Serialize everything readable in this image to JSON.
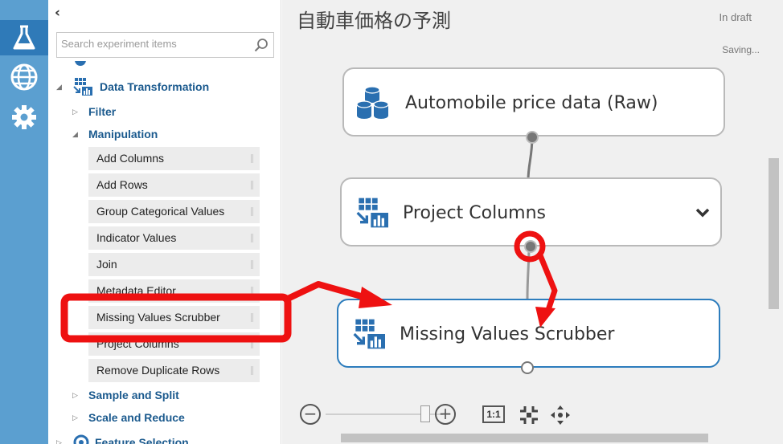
{
  "palette": {
    "collapse_glyph": "‹",
    "search_placeholder": "Search experiment items",
    "category_data_transformation": "Data Transformation",
    "subcat_filter": "Filter",
    "subcat_manipulation": "Manipulation",
    "manipulation_items": [
      "Add Columns",
      "Add Rows",
      "Group Categorical Values",
      "Indicator Values",
      "Join",
      "Metadata Editor",
      "Missing Values Scrubber",
      "Project Columns",
      "Remove Duplicate Rows"
    ],
    "subcat_sample_split": "Sample and Split",
    "subcat_scale_reduce": "Scale and Reduce",
    "category_feature_selection": "Feature Selection"
  },
  "canvas": {
    "title": "自動車価格の予測",
    "status": "In draft",
    "saving": "Saving...",
    "modules": {
      "dataset": "Automobile price data (Raw)",
      "project_columns": "Project Columns",
      "missing_values": "Missing Values Scrubber"
    },
    "zoom": {
      "minus": "−",
      "plus": "+",
      "one_to_one": "1:1",
      "level": 0.85
    }
  },
  "colors": {
    "rail": "#5b9fd0",
    "rail_active": "#2f7ab8",
    "category_text": "#1b5a8e",
    "selected_border": "#2d7dbd",
    "annotation": "#ee1111"
  },
  "icons": {
    "rail": [
      "flask-icon",
      "globe-icon",
      "gear-icon"
    ],
    "search": "search-icon",
    "dataset": "database-icon",
    "transform": "data-transform-icon"
  }
}
